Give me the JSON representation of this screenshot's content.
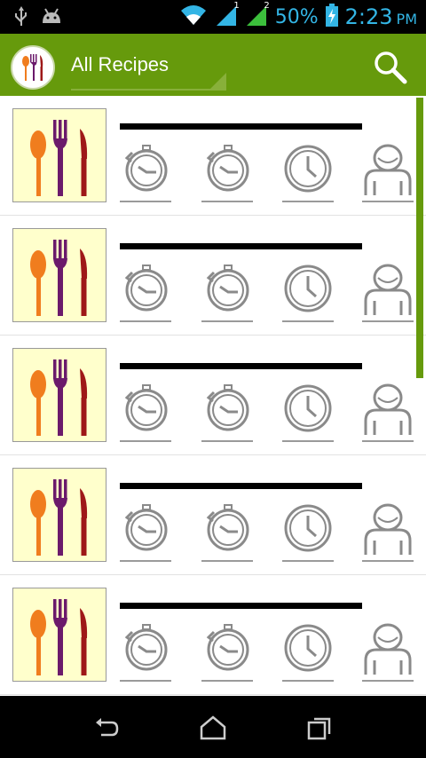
{
  "status_bar": {
    "icons": [
      "usb-icon",
      "android-icon",
      "wifi-icon",
      "signal-1-icon",
      "signal-2-icon",
      "battery-charging-icon"
    ],
    "signal_1_label": "1",
    "signal_2_label": "2",
    "battery_percent": "50%",
    "time": "2:23",
    "ampm": "PM"
  },
  "action_bar": {
    "title": "All Recipes",
    "search_icon": "search-icon",
    "logo_icon": "cutlery-logo-icon",
    "color": "#669a0c"
  },
  "recipes": [
    {
      "thumbnail": "cutlery-thumbnail",
      "meta_icons": [
        "prep-timer-icon",
        "cook-timer-icon",
        "total-time-clock-icon",
        "servings-person-icon"
      ]
    },
    {
      "thumbnail": "cutlery-thumbnail",
      "meta_icons": [
        "prep-timer-icon",
        "cook-timer-icon",
        "total-time-clock-icon",
        "servings-person-icon"
      ]
    },
    {
      "thumbnail": "cutlery-thumbnail",
      "meta_icons": [
        "prep-timer-icon",
        "cook-timer-icon",
        "total-time-clock-icon",
        "servings-person-icon"
      ]
    },
    {
      "thumbnail": "cutlery-thumbnail",
      "meta_icons": [
        "prep-timer-icon",
        "cook-timer-icon",
        "total-time-clock-icon",
        "servings-person-icon"
      ]
    },
    {
      "thumbnail": "cutlery-thumbnail",
      "meta_icons": [
        "prep-timer-icon",
        "cook-timer-icon",
        "total-time-clock-icon",
        "servings-person-icon"
      ]
    }
  ],
  "nav_bar": {
    "buttons": [
      "back-icon",
      "home-icon",
      "recent-apps-icon"
    ]
  }
}
